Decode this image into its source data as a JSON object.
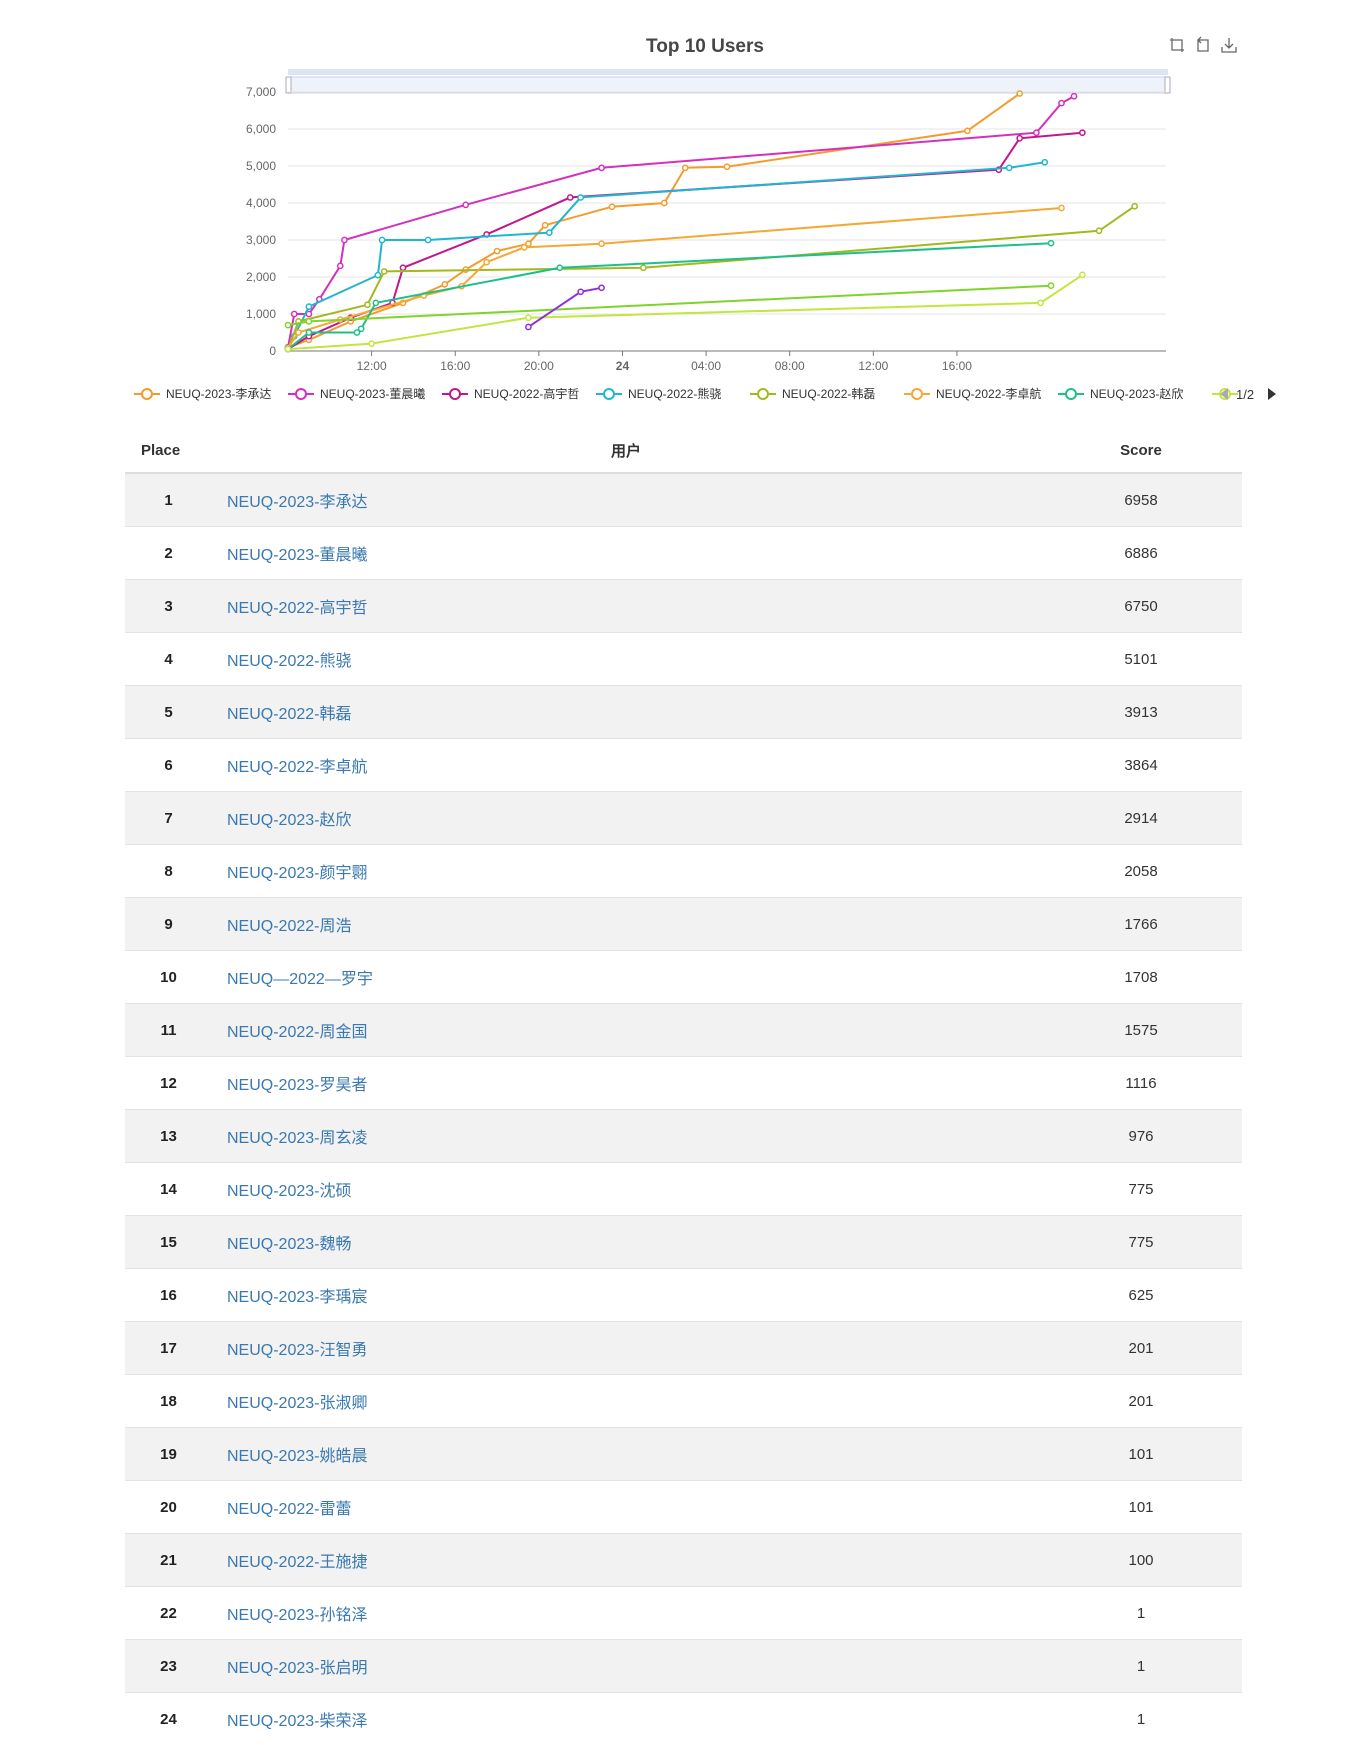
{
  "chart": {
    "title": "Top 10 Users",
    "y_ticks": [
      "0",
      "1,000",
      "2,000",
      "3,000",
      "4,000",
      "5,000",
      "6,000",
      "7,000"
    ],
    "x_ticks": [
      "12:00",
      "16:00",
      "20:00",
      "24",
      "04:00",
      "08:00",
      "12:00",
      "16:00"
    ],
    "legend_page": "1/2",
    "icons": [
      "zoom-icon",
      "zoom-reset-icon",
      "save-image-icon"
    ]
  },
  "chart_data": {
    "type": "line",
    "title": "Top 10 Users",
    "y_range": [
      0,
      7000
    ],
    "x_unit": "hours since first tick (08:00 day 1)",
    "series": [
      {
        "name": "NEUQ-2023-李承达",
        "color": "#f39c2b",
        "points": [
          [
            0,
            100
          ],
          [
            1,
            300
          ],
          [
            3,
            800
          ],
          [
            5.5,
            1300
          ],
          [
            7.5,
            1800
          ],
          [
            8.5,
            2200
          ],
          [
            10,
            2700
          ],
          [
            11.5,
            2900
          ],
          [
            12.3,
            3400
          ],
          [
            15.5,
            3900
          ],
          [
            18,
            4000
          ],
          [
            19,
            4950
          ],
          [
            21,
            4980
          ],
          [
            32.5,
            5950
          ],
          [
            35,
            6958
          ]
        ]
      },
      {
        "name": "NEUQ-2023-董晨曦",
        "color": "#d42fbf",
        "points": [
          [
            0,
            100
          ],
          [
            0.3,
            1000
          ],
          [
            1,
            1000
          ],
          [
            1.5,
            1400
          ],
          [
            2.5,
            2300
          ],
          [
            2.7,
            3000
          ],
          [
            8.5,
            3950
          ],
          [
            15,
            4950
          ],
          [
            35.8,
            5900
          ],
          [
            37,
            6700
          ],
          [
            37.6,
            6886
          ]
        ]
      },
      {
        "name": "NEUQ-2022-高宇哲",
        "color": "#c0178e",
        "points": [
          [
            0,
            50
          ],
          [
            1,
            400
          ],
          [
            3,
            900
          ],
          [
            5,
            1300
          ],
          [
            5.5,
            2250
          ],
          [
            9.5,
            3150
          ],
          [
            13.5,
            4150
          ],
          [
            34,
            4900
          ],
          [
            35,
            5750
          ],
          [
            38,
            5900
          ]
        ]
      },
      {
        "name": "NEUQ-2022-熊骁",
        "color": "#1fb7cf",
        "points": [
          [
            0,
            50
          ],
          [
            0.3,
            400
          ],
          [
            1,
            1200
          ],
          [
            4.3,
            2050
          ],
          [
            4.5,
            3000
          ],
          [
            6.7,
            3000
          ],
          [
            12.5,
            3200
          ],
          [
            14,
            4150
          ],
          [
            34.5,
            4950
          ],
          [
            36.2,
            5101
          ]
        ]
      },
      {
        "name": "NEUQ-2022-韩磊",
        "color": "#a4b81a",
        "points": [
          [
            0,
            50
          ],
          [
            0.5,
            800
          ],
          [
            3.8,
            1250
          ],
          [
            4.6,
            2150
          ],
          [
            17,
            2250
          ],
          [
            38.8,
            3250
          ],
          [
            40.5,
            3913
          ]
        ]
      },
      {
        "name": "NEUQ-2022-李卓航",
        "color": "#f5a833",
        "points": [
          [
            0,
            80
          ],
          [
            0.5,
            500
          ],
          [
            2.5,
            850
          ],
          [
            6.5,
            1500
          ],
          [
            8.3,
            1750
          ],
          [
            9.5,
            2400
          ],
          [
            11.3,
            2800
          ],
          [
            15,
            2900
          ],
          [
            37,
            3864
          ]
        ]
      },
      {
        "name": "NEUQ-2023-赵欣",
        "color": "#1cc08d",
        "points": [
          [
            0,
            50
          ],
          [
            1,
            500
          ],
          [
            3.3,
            500
          ],
          [
            3.5,
            600
          ],
          [
            4.2,
            1300
          ],
          [
            13,
            2250
          ],
          [
            36.5,
            2914
          ]
        ]
      },
      {
        "name": "NEUQ-2023-颜宇翾",
        "color": "#c2e63b",
        "points": [
          [
            0,
            50
          ],
          [
            4,
            200
          ],
          [
            11.5,
            900
          ],
          [
            36,
            1300
          ],
          [
            38,
            2058
          ]
        ]
      },
      {
        "name": "NEUQ-2022-周浩",
        "color": "#7ed42a",
        "points": [
          [
            0,
            700
          ],
          [
            1,
            800
          ],
          [
            36.5,
            1766
          ]
        ]
      },
      {
        "name": "NEUQ—2022—罗宇",
        "color": "#8e2ee0",
        "points": [
          [
            11.5,
            650
          ],
          [
            14,
            1600
          ],
          [
            15,
            1708
          ]
        ]
      }
    ]
  },
  "legend": [
    {
      "label": "NEUQ-2023-李承达",
      "color": "#f39c2b"
    },
    {
      "label": "NEUQ-2023-董晨曦",
      "color": "#d42fbf"
    },
    {
      "label": "NEUQ-2022-高宇哲",
      "color": "#c0178e"
    },
    {
      "label": "NEUQ-2022-熊骁",
      "color": "#1fb7cf"
    },
    {
      "label": "NEUQ-2022-韩磊",
      "color": "#a4b81a"
    },
    {
      "label": "NEUQ-2022-李卓航",
      "color": "#f5a833"
    },
    {
      "label": "NEUQ-2023-赵欣",
      "color": "#1cc08d"
    },
    {
      "label": "",
      "color": "#c2e63b"
    }
  ],
  "table": {
    "headers": {
      "place": "Place",
      "user": "用户",
      "score": "Score"
    },
    "rows": [
      {
        "place": "1",
        "user": "NEUQ-2023-李承达",
        "score": "6958"
      },
      {
        "place": "2",
        "user": "NEUQ-2023-董晨曦",
        "score": "6886"
      },
      {
        "place": "3",
        "user": "NEUQ-2022-高宇哲",
        "score": "6750"
      },
      {
        "place": "4",
        "user": "NEUQ-2022-熊骁",
        "score": "5101"
      },
      {
        "place": "5",
        "user": "NEUQ-2022-韩磊",
        "score": "3913"
      },
      {
        "place": "6",
        "user": "NEUQ-2022-李卓航",
        "score": "3864"
      },
      {
        "place": "7",
        "user": "NEUQ-2023-赵欣",
        "score": "2914"
      },
      {
        "place": "8",
        "user": "NEUQ-2023-颜宇翾",
        "score": "2058"
      },
      {
        "place": "9",
        "user": "NEUQ-2022-周浩",
        "score": "1766"
      },
      {
        "place": "10",
        "user": "NEUQ—2022—罗宇",
        "score": "1708"
      },
      {
        "place": "11",
        "user": "NEUQ-2022-周金国",
        "score": "1575"
      },
      {
        "place": "12",
        "user": "NEUQ-2023-罗昊者",
        "score": "1116"
      },
      {
        "place": "13",
        "user": "NEUQ-2023-周玄凌",
        "score": "976"
      },
      {
        "place": "14",
        "user": "NEUQ-2023-沈硕",
        "score": "775"
      },
      {
        "place": "15",
        "user": "NEUQ-2023-魏畅",
        "score": "775"
      },
      {
        "place": "16",
        "user": "NEUQ-2023-李瑀宸",
        "score": "625"
      },
      {
        "place": "17",
        "user": "NEUQ-2023-汪智勇",
        "score": "201"
      },
      {
        "place": "18",
        "user": "NEUQ-2023-张淑卿",
        "score": "201"
      },
      {
        "place": "19",
        "user": "NEUQ-2023-姚皓晨",
        "score": "101"
      },
      {
        "place": "20",
        "user": "NEUQ-2022-雷蕾",
        "score": "101"
      },
      {
        "place": "21",
        "user": "NEUQ-2022-王施捷",
        "score": "100"
      },
      {
        "place": "22",
        "user": "NEUQ-2023-孙铭泽",
        "score": "1"
      },
      {
        "place": "23",
        "user": "NEUQ-2023-张启明",
        "score": "1"
      },
      {
        "place": "24",
        "user": "NEUQ-2023-柴荣泽",
        "score": "1"
      }
    ]
  }
}
